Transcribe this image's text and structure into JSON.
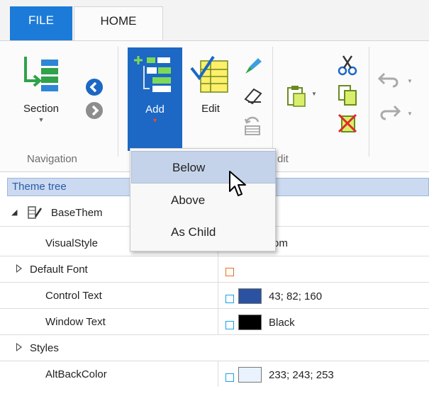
{
  "tabs": {
    "file_label": "FILE",
    "home_label": "HOME"
  },
  "ribbon": {
    "navigation": {
      "group_label": "Navigation",
      "section_label": "Section"
    },
    "edit_group": {
      "group_label": "Edit",
      "group_label_visible": "dit",
      "add_label": "Add",
      "edit_label": "Edit"
    }
  },
  "dropdown": {
    "items": [
      "Below",
      "Above",
      "As Child"
    ],
    "highlighted": "Below"
  },
  "search": {
    "placeholder": "Theme tree"
  },
  "tree": {
    "root_label": "BaseThem",
    "rows": [
      {
        "name": "VisualStyle",
        "value": "om"
      },
      {
        "name": "Default Font",
        "value": ""
      },
      {
        "name": "Control Text",
        "value": "43; 82; 160",
        "color": "#2b52a0"
      },
      {
        "name": "Window Text",
        "value": "Black",
        "color": "#000000"
      },
      {
        "name": "Styles",
        "value": ""
      },
      {
        "name": "AltBackColor",
        "value": "233; 243; 253",
        "color": "#e9f3fd"
      }
    ]
  },
  "colors": {
    "accent": "#1c7bd8",
    "add_button": "#1c68c4",
    "menu_highlight": "#c5d3ea",
    "search_bg": "#cbdaf0"
  }
}
